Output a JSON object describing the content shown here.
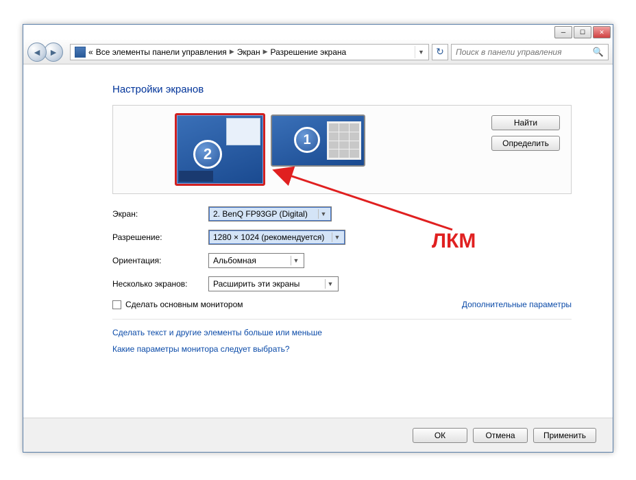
{
  "breadcrumbs": {
    "prefix": "«",
    "root": "Все элементы панели управления",
    "mid": "Экран",
    "leaf": "Разрешение экрана"
  },
  "search": {
    "placeholder": "Поиск в панели управления"
  },
  "heading": "Настройки экранов",
  "monitors": {
    "n2": "2",
    "n1": "1"
  },
  "side_buttons": {
    "find": "Найти",
    "identify": "Определить"
  },
  "labels": {
    "display": "Экран:",
    "resolution": "Разрешение:",
    "orientation": "Ориентация:",
    "multi": "Несколько экранов:"
  },
  "values": {
    "display": "2. BenQ FP93GP (Digital)",
    "resolution": "1280 × 1024 (рекомендуется)",
    "orientation": "Альбомная",
    "multi": "Расширить эти экраны"
  },
  "checkbox": {
    "primary": "Сделать основным монитором"
  },
  "links": {
    "advanced": "Дополнительные параметры",
    "text_size": "Сделать текст и другие элементы больше или меньше",
    "which": "Какие параметры монитора следует выбрать?"
  },
  "buttons": {
    "ok": "ОК",
    "cancel": "Отмена",
    "apply": "Применить"
  },
  "annotation": {
    "lmb": "ЛКМ"
  }
}
